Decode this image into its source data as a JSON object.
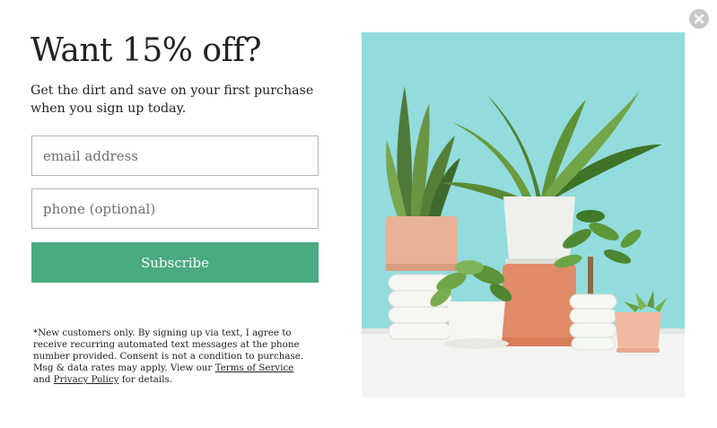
{
  "popup": {
    "heading": "Want 15% off?",
    "subheading": "Get the dirt and save on your first purchase when you sign up today.",
    "email_placeholder": "email address",
    "phone_placeholder": "phone (optional)",
    "subscribe_label": "Subscribe",
    "disclaimer_before": "*New customers only. By signing up via text, I agree to receive recurring automated text messages at the phone number provided. Consent is not a condition to purchase. Msg & data rates may apply. View our ",
    "terms_link": "Terms of Service",
    "disclaimer_and": " and ",
    "privacy_link": "Privacy Policy",
    "disclaimer_after": " for details.",
    "close_icon": "close-x-icon",
    "image_subject": "potted-plants-photo"
  },
  "colors": {
    "subscribe_button": "#4aaa82",
    "photo_background": "#93dcdd",
    "close_button": "#c9c9c9",
    "input_border": "#b5b5b5"
  }
}
